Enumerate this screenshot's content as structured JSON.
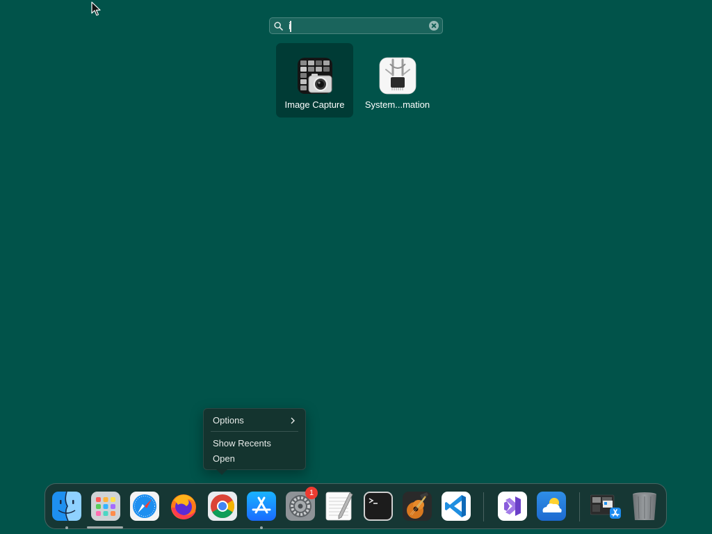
{
  "search": {
    "value": "i"
  },
  "results": [
    {
      "label": "Image Capture",
      "icon": "image-capture-icon",
      "selected": true
    },
    {
      "label": "System...mation",
      "icon": "system-information-icon",
      "selected": false
    }
  ],
  "context_menu": {
    "items": [
      {
        "label": "Options",
        "has_submenu": true
      },
      {
        "label": "Show Recents",
        "has_submenu": false
      },
      {
        "label": "Open",
        "has_submenu": false
      }
    ]
  },
  "dock": {
    "apps": [
      {
        "name": "Finder",
        "icon": "finder-icon",
        "running": true
      },
      {
        "name": "Launchpad",
        "icon": "launchpad-icon",
        "running": false
      },
      {
        "name": "Safari",
        "icon": "safari-icon",
        "running": false
      },
      {
        "name": "Firefox",
        "icon": "firefox-icon",
        "running": false
      },
      {
        "name": "Google Chrome",
        "icon": "chrome-icon",
        "running": false
      },
      {
        "name": "App Store",
        "icon": "app-store-icon",
        "running": true
      },
      {
        "name": "System Preferences",
        "icon": "system-preferences-icon",
        "running": false,
        "badge": "1"
      },
      {
        "name": "TextEdit",
        "icon": "textedit-icon",
        "running": false
      },
      {
        "name": "Terminal",
        "icon": "terminal-icon",
        "running": false
      },
      {
        "name": "GarageBand",
        "icon": "garageband-icon",
        "running": false
      },
      {
        "name": "Visual Studio Code",
        "icon": "vscode-icon",
        "running": false
      },
      {
        "name": "Visual Studio",
        "icon": "visual-studio-icon",
        "running": false
      },
      {
        "name": "Weather",
        "icon": "weather-icon",
        "running": false
      },
      {
        "name": "Downloads",
        "icon": "downloads-stack-icon",
        "running": false
      },
      {
        "name": "Trash",
        "icon": "trash-icon",
        "running": false
      }
    ]
  },
  "colors": {
    "desktop": "#01534a",
    "badge": "#ee3b31",
    "selection": "rgba(0,0,0,0.28)"
  }
}
